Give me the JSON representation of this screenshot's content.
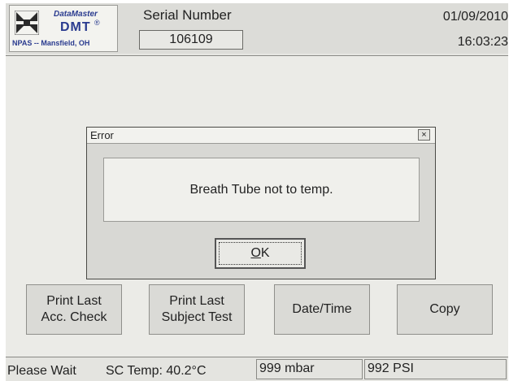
{
  "header": {
    "logo": {
      "name_line1": "DataMaster",
      "name_line2": "DMT",
      "registered": "®",
      "org": "NPAS -- Mansfield, OH"
    },
    "serial_label": "Serial Number",
    "serial_value": "106109",
    "date": "01/09/2010",
    "time": "16:03:23"
  },
  "dialog": {
    "title": "Error",
    "close_glyph": "×",
    "message": "Breath Tube not to temp.",
    "ok_accel": "O",
    "ok_rest": "K"
  },
  "buttons": {
    "print_acc": {
      "line1": "Print Last",
      "line2": "Acc. Check"
    },
    "print_subject": {
      "line1": "Print Last",
      "line2": "Subject Test"
    },
    "date_time": {
      "label": "Date/Time"
    },
    "copy": {
      "label": "Copy"
    }
  },
  "status": {
    "message": "Please Wait",
    "sc_temp": "SC Temp: 40.2°C",
    "pressure_mbar": "999 mbar",
    "pressure_psi": "992 PSI"
  },
  "colors": {
    "logo_text": "#2a3b8f",
    "screen_bg": "#e6e6e2"
  }
}
